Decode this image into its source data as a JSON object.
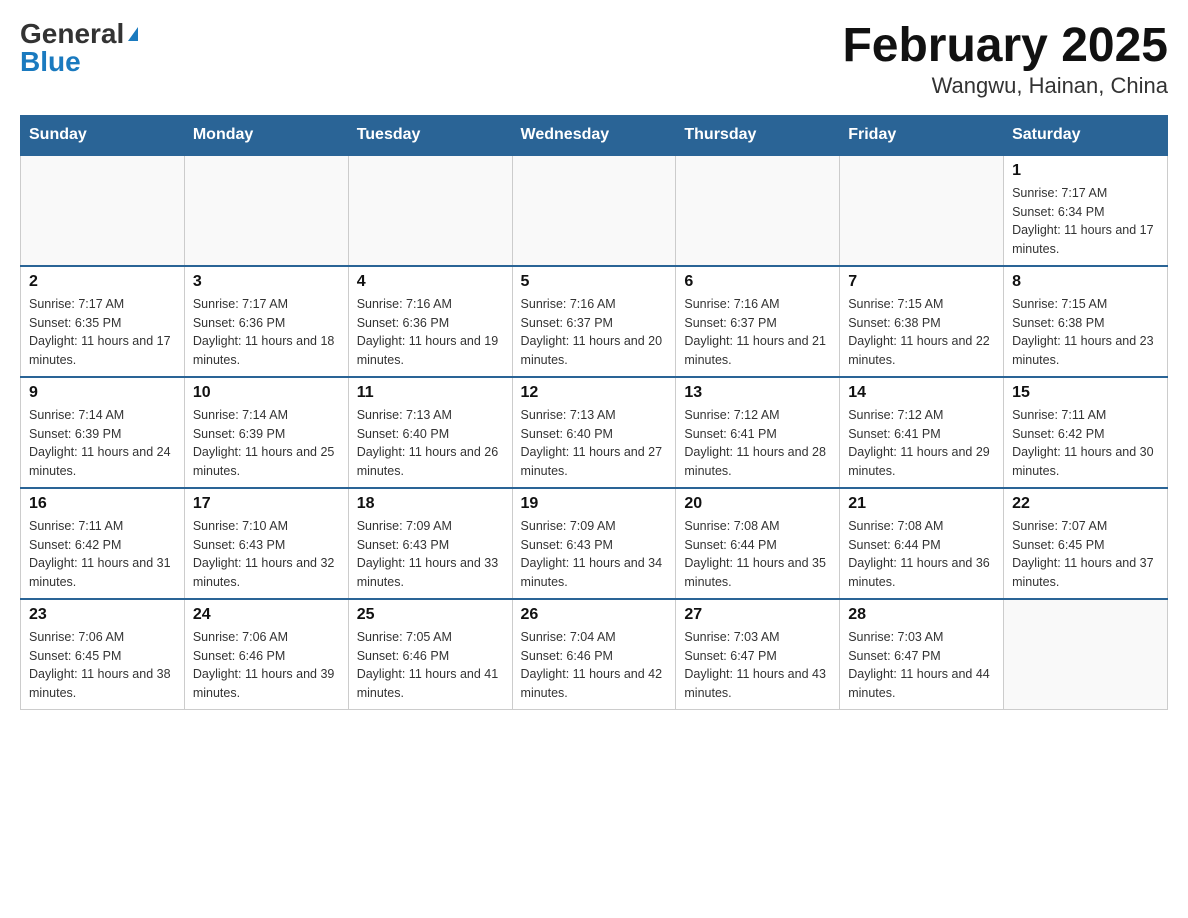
{
  "header": {
    "logo_general": "General",
    "logo_blue": "Blue",
    "title": "February 2025",
    "subtitle": "Wangwu, Hainan, China"
  },
  "days_of_week": [
    "Sunday",
    "Monday",
    "Tuesday",
    "Wednesday",
    "Thursday",
    "Friday",
    "Saturday"
  ],
  "weeks": [
    [
      {
        "day": "",
        "info": ""
      },
      {
        "day": "",
        "info": ""
      },
      {
        "day": "",
        "info": ""
      },
      {
        "day": "",
        "info": ""
      },
      {
        "day": "",
        "info": ""
      },
      {
        "day": "",
        "info": ""
      },
      {
        "day": "1",
        "info": "Sunrise: 7:17 AM\nSunset: 6:34 PM\nDaylight: 11 hours and 17 minutes."
      }
    ],
    [
      {
        "day": "2",
        "info": "Sunrise: 7:17 AM\nSunset: 6:35 PM\nDaylight: 11 hours and 17 minutes."
      },
      {
        "day": "3",
        "info": "Sunrise: 7:17 AM\nSunset: 6:36 PM\nDaylight: 11 hours and 18 minutes."
      },
      {
        "day": "4",
        "info": "Sunrise: 7:16 AM\nSunset: 6:36 PM\nDaylight: 11 hours and 19 minutes."
      },
      {
        "day": "5",
        "info": "Sunrise: 7:16 AM\nSunset: 6:37 PM\nDaylight: 11 hours and 20 minutes."
      },
      {
        "day": "6",
        "info": "Sunrise: 7:16 AM\nSunset: 6:37 PM\nDaylight: 11 hours and 21 minutes."
      },
      {
        "day": "7",
        "info": "Sunrise: 7:15 AM\nSunset: 6:38 PM\nDaylight: 11 hours and 22 minutes."
      },
      {
        "day": "8",
        "info": "Sunrise: 7:15 AM\nSunset: 6:38 PM\nDaylight: 11 hours and 23 minutes."
      }
    ],
    [
      {
        "day": "9",
        "info": "Sunrise: 7:14 AM\nSunset: 6:39 PM\nDaylight: 11 hours and 24 minutes."
      },
      {
        "day": "10",
        "info": "Sunrise: 7:14 AM\nSunset: 6:39 PM\nDaylight: 11 hours and 25 minutes."
      },
      {
        "day": "11",
        "info": "Sunrise: 7:13 AM\nSunset: 6:40 PM\nDaylight: 11 hours and 26 minutes."
      },
      {
        "day": "12",
        "info": "Sunrise: 7:13 AM\nSunset: 6:40 PM\nDaylight: 11 hours and 27 minutes."
      },
      {
        "day": "13",
        "info": "Sunrise: 7:12 AM\nSunset: 6:41 PM\nDaylight: 11 hours and 28 minutes."
      },
      {
        "day": "14",
        "info": "Sunrise: 7:12 AM\nSunset: 6:41 PM\nDaylight: 11 hours and 29 minutes."
      },
      {
        "day": "15",
        "info": "Sunrise: 7:11 AM\nSunset: 6:42 PM\nDaylight: 11 hours and 30 minutes."
      }
    ],
    [
      {
        "day": "16",
        "info": "Sunrise: 7:11 AM\nSunset: 6:42 PM\nDaylight: 11 hours and 31 minutes."
      },
      {
        "day": "17",
        "info": "Sunrise: 7:10 AM\nSunset: 6:43 PM\nDaylight: 11 hours and 32 minutes."
      },
      {
        "day": "18",
        "info": "Sunrise: 7:09 AM\nSunset: 6:43 PM\nDaylight: 11 hours and 33 minutes."
      },
      {
        "day": "19",
        "info": "Sunrise: 7:09 AM\nSunset: 6:43 PM\nDaylight: 11 hours and 34 minutes."
      },
      {
        "day": "20",
        "info": "Sunrise: 7:08 AM\nSunset: 6:44 PM\nDaylight: 11 hours and 35 minutes."
      },
      {
        "day": "21",
        "info": "Sunrise: 7:08 AM\nSunset: 6:44 PM\nDaylight: 11 hours and 36 minutes."
      },
      {
        "day": "22",
        "info": "Sunrise: 7:07 AM\nSunset: 6:45 PM\nDaylight: 11 hours and 37 minutes."
      }
    ],
    [
      {
        "day": "23",
        "info": "Sunrise: 7:06 AM\nSunset: 6:45 PM\nDaylight: 11 hours and 38 minutes."
      },
      {
        "day": "24",
        "info": "Sunrise: 7:06 AM\nSunset: 6:46 PM\nDaylight: 11 hours and 39 minutes."
      },
      {
        "day": "25",
        "info": "Sunrise: 7:05 AM\nSunset: 6:46 PM\nDaylight: 11 hours and 41 minutes."
      },
      {
        "day": "26",
        "info": "Sunrise: 7:04 AM\nSunset: 6:46 PM\nDaylight: 11 hours and 42 minutes."
      },
      {
        "day": "27",
        "info": "Sunrise: 7:03 AM\nSunset: 6:47 PM\nDaylight: 11 hours and 43 minutes."
      },
      {
        "day": "28",
        "info": "Sunrise: 7:03 AM\nSunset: 6:47 PM\nDaylight: 11 hours and 44 minutes."
      },
      {
        "day": "",
        "info": ""
      }
    ]
  ]
}
